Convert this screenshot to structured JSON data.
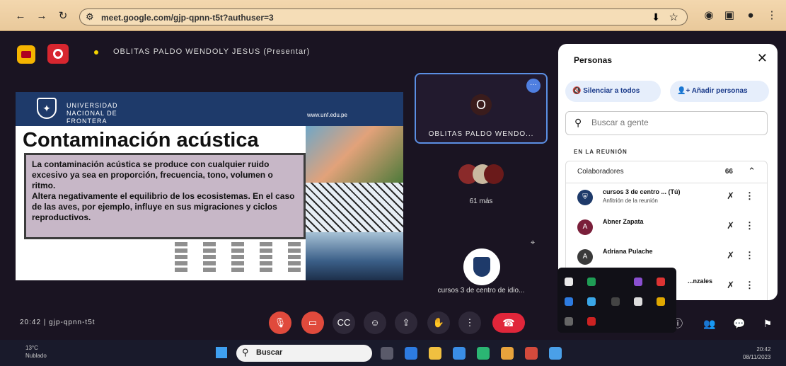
{
  "browser": {
    "url": "meet.google.com/gjp-qpnn-t5t?authuser=3",
    "back_icon": "arrow-left-icon",
    "forward_icon": "arrow-right-icon",
    "reload_icon": "reload-icon"
  },
  "meet": {
    "presenting_label": "OBLITAS PALDO WENDOLY JESUS (Presentar)",
    "time_label": "20:42 | gjp-qpnn-t5t"
  },
  "slide": {
    "university": "UNIVERSIDAD\nNACIONAL DE\nFRONTERA",
    "web": "www.unf.edu.pe",
    "title": "Contaminación acústica",
    "paragraph1": "La contaminación acústica se produce con cualquier ruido excesivo ya sea en proporción, frecuencia, tono, volumen o ritmo.",
    "paragraph2": "Altera negativamente el equilibrio de los ecosistemas. En el caso de las aves, por ejemplo, influye en sus migraciones y ciclos reproductivos."
  },
  "tiles": {
    "self_initial": "O",
    "self_name": "OBLITAS PALDO WENDO...",
    "more_label": "···",
    "group_name": "61 más",
    "host_name": "cursos 3 de centro de idio..."
  },
  "people_panel": {
    "title": "Personas",
    "close": "✕",
    "mute_all": "Silenciar a todos",
    "add_people": "Añadir personas",
    "search_placeholder": "Buscar a gente",
    "section": "EN LA REUNIÓN",
    "group_label": "Colaboradores",
    "group_count": "66",
    "participants": [
      {
        "name": "cursos 3 de centro ... (Tú)",
        "sub": "Anfitrión de la reunión",
        "initial": "",
        "color": "#1e3a6a"
      },
      {
        "name": "Abner Zapata",
        "sub": "",
        "initial": "A",
        "color": "#7a1f3a"
      },
      {
        "name": "Adriana Pulache",
        "sub": "",
        "initial": "A",
        "color": "#3a3a3a"
      },
      {
        "name": "...nzales",
        "sub": "",
        "initial": "",
        "color": "#5a4a3a"
      }
    ]
  },
  "controls": {
    "mic_icon": "mic-off-icon",
    "cam_icon": "camera-icon",
    "cc_icon": "captions-icon",
    "emoji_icon": "emoji-icon",
    "present_icon": "present-icon",
    "hand_icon": "hand-icon",
    "more_icon": "more-vert-icon",
    "leave_icon": "call-end-icon"
  },
  "taskbar": {
    "weather": "13°C\nNublado",
    "search_label": "Buscar",
    "clock": "20:42\n08/11/2023"
  }
}
